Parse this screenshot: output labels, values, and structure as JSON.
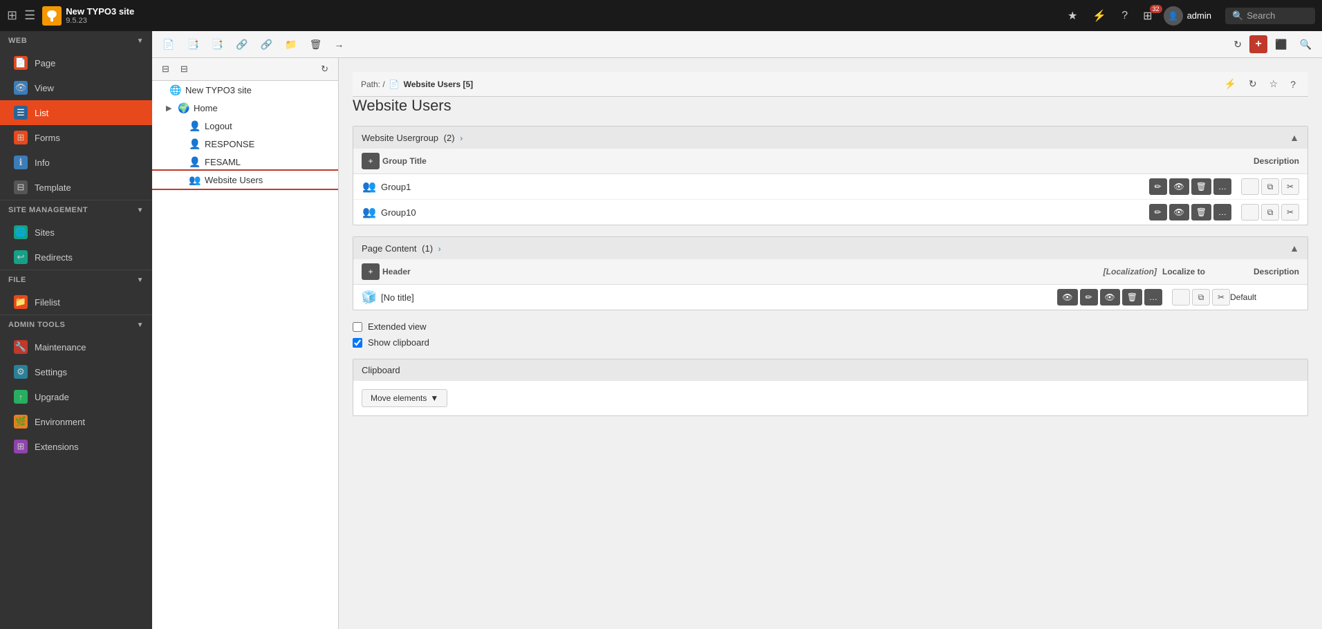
{
  "topbar": {
    "grid_icon": "⊞",
    "menu_icon": "☰",
    "logo_text": "T3",
    "site_name": "New TYPO3 site",
    "site_version": "9.5.23",
    "bookmark_icon": "★",
    "bolt_icon": "⚡",
    "help_icon": "?",
    "notification_icon": "⊞",
    "notification_count": "32",
    "user_icon": "👤",
    "username": "admin",
    "search_icon": "🔍",
    "search_label": "Search"
  },
  "sidebar": {
    "web_label": "WEB",
    "web_arrow": "▼",
    "page_label": "Page",
    "view_label": "View",
    "list_label": "List",
    "forms_label": "Forms",
    "info_label": "Info",
    "template_label": "Template",
    "site_management_label": "SITE MANAGEMENT",
    "sites_label": "Sites",
    "redirects_label": "Redirects",
    "file_label": "FILE",
    "filelist_label": "Filelist",
    "admin_tools_label": "ADMIN TOOLS",
    "maintenance_label": "Maintenance",
    "settings_label": "Settings",
    "upgrade_label": "Upgrade",
    "environment_label": "Environment",
    "extensions_label": "Extensions"
  },
  "toolbar": {
    "new_doc_icon": "📄",
    "filter_icon": "⊟",
    "refresh_icon": "↻",
    "plus_icon": "+",
    "export_icon": "⬛",
    "search_icon": "🔍"
  },
  "tree": {
    "collapse_icon": "⊟",
    "filter_icon": "⊟",
    "refresh_icon": "↻",
    "items": [
      {
        "label": "New TYPO3 site",
        "icon": "🌐",
        "indent": 0,
        "chevron": ""
      },
      {
        "label": "Home",
        "icon": "🌍",
        "indent": 1,
        "chevron": "▶"
      },
      {
        "label": "Logout",
        "icon": "👤",
        "indent": 2,
        "chevron": ""
      },
      {
        "label": "RESPONSE",
        "icon": "👤",
        "indent": 2,
        "chevron": ""
      },
      {
        "label": "FESAML",
        "icon": "👤",
        "indent": 2,
        "chevron": ""
      },
      {
        "label": "Website Users",
        "icon": "👥",
        "indent": 2,
        "chevron": "",
        "selected": true
      }
    ]
  },
  "path_bar": {
    "path_label": "Path:",
    "page_icon": "📄",
    "page_name": "Website Users [5]"
  },
  "page_title": "Website Users",
  "usergroup_section": {
    "title": "Website Usergroup",
    "count": "(2)",
    "arrow": "›",
    "collapse_icon": "▲",
    "table_header_plus": "+",
    "table_header_title": "Group Title",
    "table_header_desc": "Description",
    "rows": [
      {
        "icon": "👥",
        "title": "Group1"
      },
      {
        "icon": "👥",
        "title": "Group10"
      }
    ]
  },
  "page_content_section": {
    "title": "Page Content",
    "count": "(1)",
    "arrow": "›",
    "collapse_icon": "▲",
    "table_header_plus": "+",
    "table_header_title": "Header",
    "table_header_localization": "[Localization]",
    "table_header_localize": "Localize to",
    "table_header_desc": "Description",
    "rows": [
      {
        "icon": "🧊",
        "title": "[No title]",
        "desc": "Default"
      }
    ]
  },
  "options": {
    "extended_view_label": "Extended view",
    "extended_view_checked": false,
    "show_clipboard_label": "Show clipboard",
    "show_clipboard_checked": true
  },
  "clipboard": {
    "title": "Clipboard",
    "move_elements_label": "Move elements",
    "dropdown_icon": "▼"
  },
  "actions": {
    "edit_icon": "✏",
    "view_icon": "👁",
    "delete_icon": "🗑",
    "more_icon": "…",
    "copy_icon": "⧉",
    "cut_icon": "✂",
    "hide_icon": "👁"
  }
}
